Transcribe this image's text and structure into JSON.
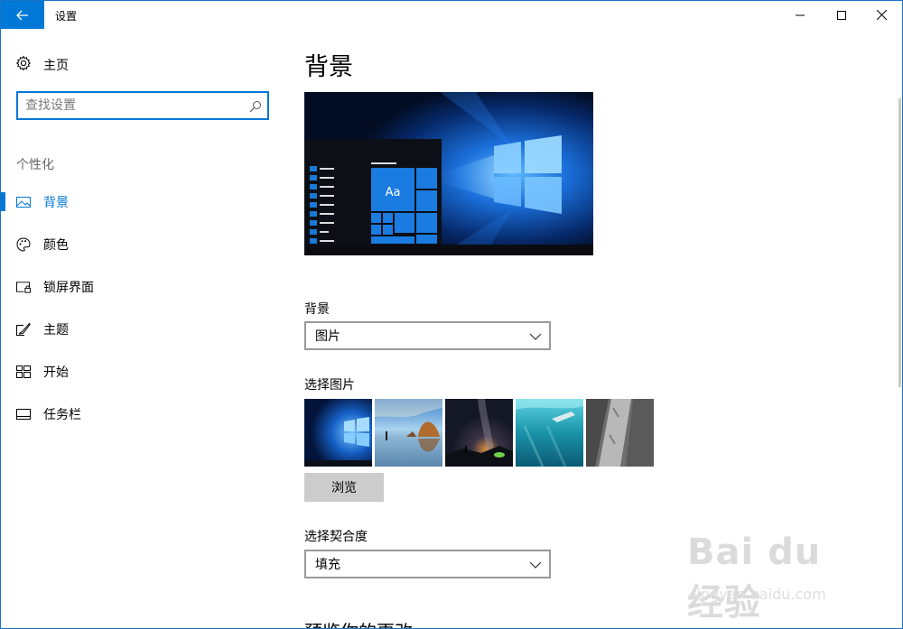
{
  "window": {
    "title": "设置"
  },
  "sidebar": {
    "home_label": "主页",
    "search_placeholder": "查找设置",
    "section_title": "个性化",
    "items": [
      {
        "label": "背景",
        "icon": "picture-icon",
        "active": true
      },
      {
        "label": "颜色",
        "icon": "palette-icon",
        "active": false
      },
      {
        "label": "锁屏界面",
        "icon": "lock-screen-icon",
        "active": false
      },
      {
        "label": "主题",
        "icon": "theme-brush-icon",
        "active": false
      },
      {
        "label": "开始",
        "icon": "start-grid-icon",
        "active": false
      },
      {
        "label": "任务栏",
        "icon": "taskbar-icon",
        "active": false
      }
    ]
  },
  "main": {
    "page_title": "背景",
    "preview_tile_label": "Aa",
    "background_label": "背景",
    "background_value": "图片",
    "choose_picture_label": "选择图片",
    "browse_label": "浏览",
    "fit_label": "选择契合度",
    "fit_value": "填充",
    "partial_heading": "预览你的更改"
  },
  "colors": {
    "accent": "#0078d7"
  },
  "watermark": {
    "line1": "Bai du 经验",
    "line2": "jingyan.baidu.com"
  }
}
